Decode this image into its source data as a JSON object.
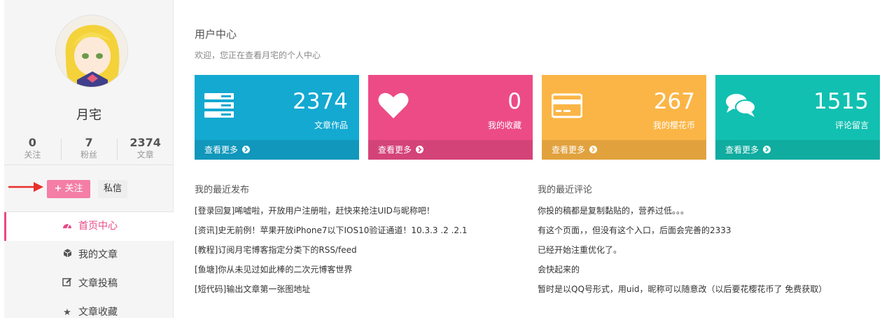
{
  "sidebar": {
    "username": "月宅",
    "stats": [
      {
        "num": "0",
        "label": "关注"
      },
      {
        "num": "7",
        "label": "粉丝"
      },
      {
        "num": "2374",
        "label": "文章"
      }
    ],
    "follow_label": "关注",
    "follow_icon": "plus-icon",
    "message_label": "私信",
    "menu": [
      {
        "label": "首页中心",
        "icon": "dashboard-icon"
      },
      {
        "label": "我的文章",
        "icon": "cube-icon"
      },
      {
        "label": "文章投稿",
        "icon": "edit-icon"
      },
      {
        "label": "文章收藏",
        "icon": "star-icon"
      }
    ]
  },
  "main": {
    "title": "用户中心",
    "subtitle": "欢迎，您正在查看月宅的个人中心",
    "cards": [
      {
        "num": "2374",
        "label": "文章作品",
        "more": "查看更多",
        "color": "#13a9d1",
        "icon": "server-icon"
      },
      {
        "num": "0",
        "label": "我的收藏",
        "more": "查看更多",
        "color": "#ec4b86",
        "icon": "heart-icon"
      },
      {
        "num": "267",
        "label": "我的樱花币",
        "more": "查看更多",
        "color": "#fbb546",
        "icon": "credit-card-icon"
      },
      {
        "num": "1515",
        "label": "评论留言",
        "more": "查看更多",
        "color": "#11c0b1",
        "icon": "comments-icon"
      }
    ],
    "recent_posts_title": "我的最近发布",
    "recent_posts": [
      "[登录回复]唏嘘啦，开放用户注册啦，赶快来抢注UID与昵称吧！",
      "[资讯]史无前例！苹果开放iPhone7以下IOS10验证通道！10.3.3 .2 .2.1",
      "[教程]订阅月宅博客指定分类下的RSS/feed",
      "[鱼塘]你从未见过如此棒的二次元博客世界",
      "[短代码]输出文章第一张图地址"
    ],
    "recent_comments_title": "我的最近评论",
    "recent_comments": [
      "你投的稿都是复制黏贴的，营养过低。。。",
      "有这个页面，，但没有这个入口，后面会完善的2333",
      "已经开始注重优化了。",
      "会快起来的",
      "暂时是以QQ号形式，用uid，昵称可以随意改（以后要花樱花币了 免费获取）"
    ]
  }
}
